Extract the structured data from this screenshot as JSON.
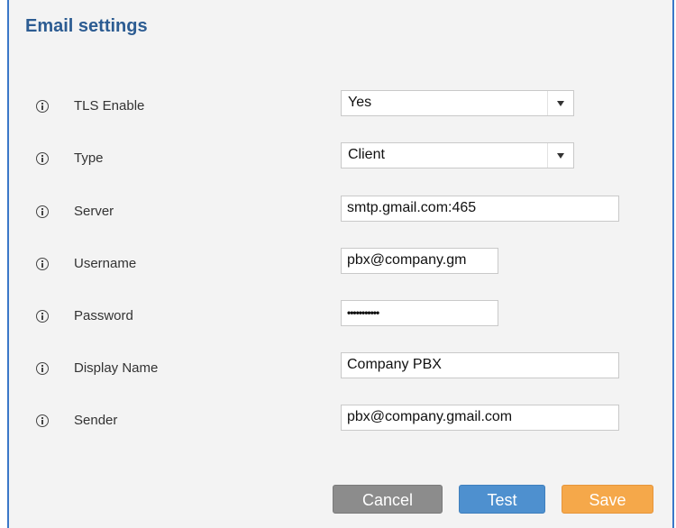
{
  "panel": {
    "title": "Email settings"
  },
  "fields": {
    "tls_enable": {
      "label": "TLS Enable",
      "value": "Yes"
    },
    "type": {
      "label": "Type",
      "value": "Client"
    },
    "server": {
      "label": "Server",
      "value": "smtp.gmail.com:465"
    },
    "username": {
      "label": "Username",
      "value": "pbx@company.gm"
    },
    "password": {
      "label": "Password",
      "value": "•••••••••••"
    },
    "display_name": {
      "label": "Display Name",
      "value": "Company PBX"
    },
    "sender": {
      "label": "Sender",
      "value": "pbx@company.gmail.com"
    }
  },
  "buttons": {
    "cancel": "Cancel",
    "test": "Test",
    "save": "Save"
  },
  "colors": {
    "accent_border": "#3b78c8",
    "title": "#2c5c92",
    "cancel_bg": "#8c8c8c",
    "test_bg": "#4e90cf",
    "save_bg": "#f5a84a"
  },
  "icons": [
    "info-icon",
    "chevron-down-icon"
  ]
}
